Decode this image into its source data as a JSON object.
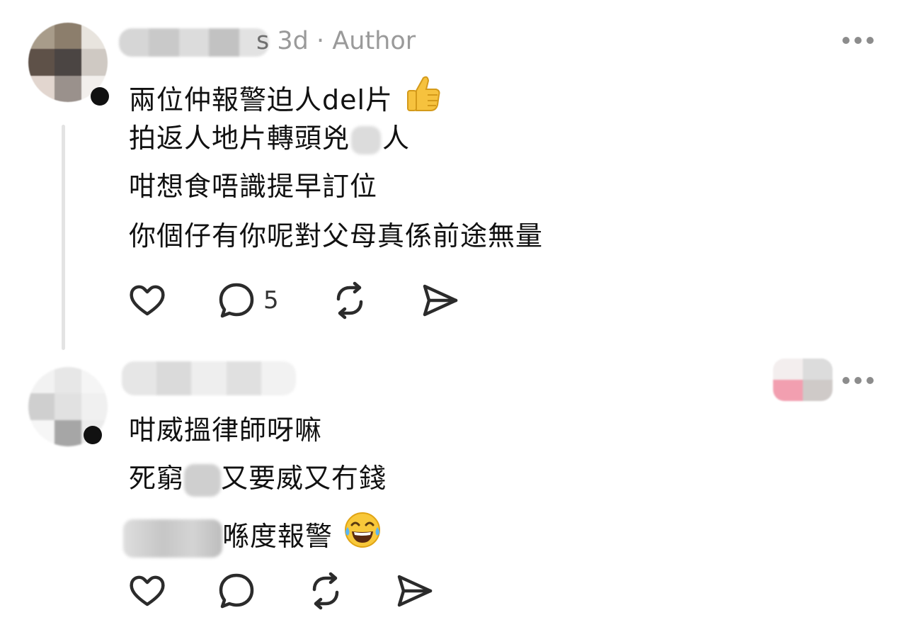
{
  "posts": [
    {
      "meta": {
        "username_tail": "s",
        "time": "3d",
        "separator": "·",
        "badge": "Author"
      },
      "body": {
        "line1": "兩位仲報警迫人del片",
        "line1_emoji": "thumbs-up",
        "line2_a": "拍返人地片轉頭兇",
        "line2_b": "人",
        "line3": "咁想食唔識提早訂位",
        "line4": "你個仔有你呢對父母真係前途無量"
      },
      "actions": {
        "like_icon": "heart-icon",
        "reply_icon": "comment-icon",
        "reply_count": "5",
        "repost_icon": "repost-icon",
        "share_icon": "send-icon"
      }
    },
    {
      "body": {
        "line1": "咁威搵律師呀嘛",
        "line2_a": "死窮",
        "line2_b": "又要威又冇錢",
        "line3_a": "’",
        "line3_b": "喺度報警",
        "line3_emoji": "tears-of-joy"
      },
      "actions": {
        "like_icon": "heart-icon",
        "reply_icon": "comment-icon",
        "repost_icon": "repost-icon",
        "share_icon": "send-icon"
      }
    }
  ],
  "colors": {
    "text": "#111111",
    "meta": "#9a9a9a",
    "icon": "#2b2b2b",
    "thread_line": "#e3e3e3"
  }
}
